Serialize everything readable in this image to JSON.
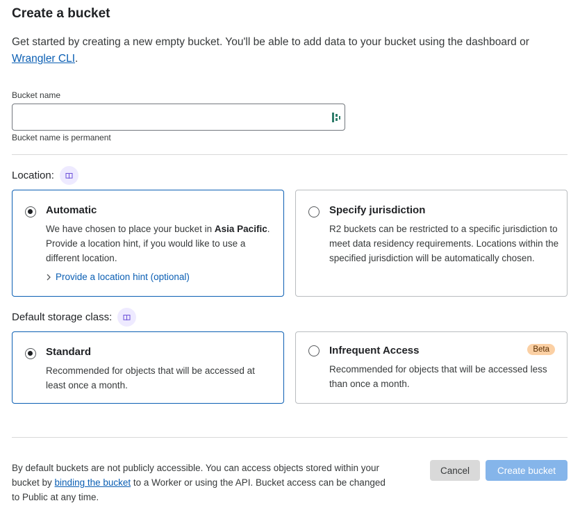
{
  "header": {
    "title": "Create a bucket"
  },
  "intro": {
    "text": "Get started by creating a new empty bucket. You'll be able to add data to your bucket using the dashboard or ",
    "link": "Wrangler CLI",
    "end": "."
  },
  "bucket_name": {
    "label": "Bucket name",
    "value": "",
    "placeholder": "",
    "help": "Bucket name is permanent",
    "icon": "password-manager-icon"
  },
  "location": {
    "label": "Location:",
    "doc_icon": "docs-book-icon",
    "options": [
      {
        "title": "Automatic",
        "selected": true,
        "desc_before": "We have chosen to place your bucket in ",
        "desc_bold": "Asia Pacific",
        "desc_after": ". Provide a location hint, if you would like to use a different location.",
        "hint_link": "Provide a location hint (optional)"
      },
      {
        "title": "Specify jurisdiction",
        "selected": false,
        "desc": "R2 buckets can be restricted to a specific jurisdiction to meet data residency requirements. Locations within the specified jurisdiction will be automatically chosen."
      }
    ]
  },
  "storage_class": {
    "label": "Default storage class:",
    "doc_icon": "docs-book-icon",
    "options": [
      {
        "title": "Standard",
        "selected": true,
        "desc": "Recommended for objects that will be accessed at least once a month."
      },
      {
        "title": "Infrequent Access",
        "selected": false,
        "badge": "Beta",
        "desc": "Recommended for objects that will be accessed less than once a month."
      }
    ]
  },
  "footer": {
    "text_before": "By default buckets are not publicly accessible. You can access objects stored within your bucket by ",
    "link": "binding the bucket",
    "text_after": " to a Worker or using the API. Bucket access can be changed to Public at any time.",
    "cancel": "Cancel",
    "create": "Create bucket"
  },
  "colors": {
    "accent": "#0a5eb3",
    "create_disabled": "#85b5ea",
    "beta_badge": "#fbd0a4",
    "doc_badge_bg": "#eeeaff"
  }
}
